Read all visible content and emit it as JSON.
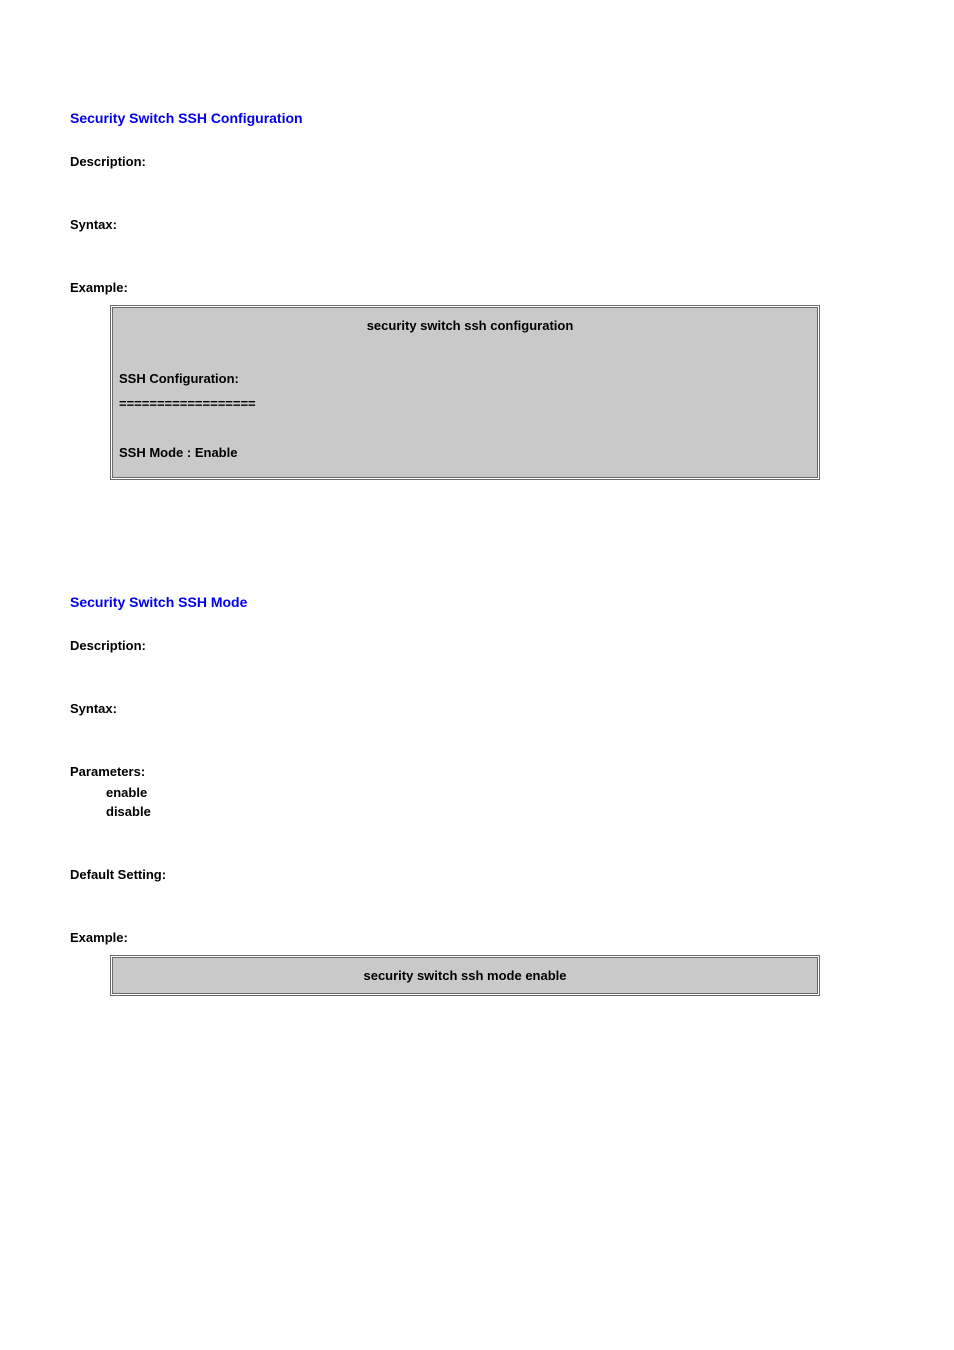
{
  "section1": {
    "heading": "Security Switch SSH Configuration",
    "labels": {
      "description": "Description:",
      "syntax": "Syntax:",
      "example": "Example:"
    },
    "code": {
      "command": "security switch ssh configuration",
      "out1": "SSH Configuration:",
      "out2": "==================",
      "out3": "SSH Mode : Enable"
    }
  },
  "section2": {
    "heading": "Security Switch SSH Mode",
    "labels": {
      "description": "Description:",
      "syntax": "Syntax:",
      "parameters": "Parameters:",
      "default_setting": "Default Setting:",
      "example": "Example:"
    },
    "params": {
      "p1": "enable",
      "p2": "disable"
    },
    "code": {
      "command": "security switch ssh mode enable"
    }
  }
}
